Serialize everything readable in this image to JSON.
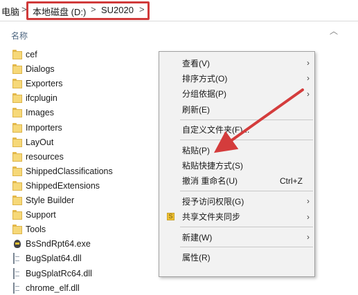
{
  "address_bar": {
    "crumbs": [
      "电脑",
      "本地磁盘 (D:)",
      "SU2020"
    ],
    "separator": ">"
  },
  "file_list": {
    "column_header": "名称",
    "items": [
      {
        "name": "cef",
        "type": "folder"
      },
      {
        "name": "Dialogs",
        "type": "folder"
      },
      {
        "name": "Exporters",
        "type": "folder"
      },
      {
        "name": "ifcplugin",
        "type": "folder"
      },
      {
        "name": "Images",
        "type": "folder"
      },
      {
        "name": "Importers",
        "type": "folder"
      },
      {
        "name": "LayOut",
        "type": "folder"
      },
      {
        "name": "resources",
        "type": "folder"
      },
      {
        "name": "ShippedClassifications",
        "type": "folder"
      },
      {
        "name": "ShippedExtensions",
        "type": "folder"
      },
      {
        "name": "Style Builder",
        "type": "folder"
      },
      {
        "name": "Support",
        "type": "folder"
      },
      {
        "name": "Tools",
        "type": "folder"
      },
      {
        "name": "BsSndRpt64.exe",
        "type": "exe"
      },
      {
        "name": "BugSplat64.dll",
        "type": "dll"
      },
      {
        "name": "BugSplatRc64.dll",
        "type": "dll"
      },
      {
        "name": "chrome_elf.dll",
        "type": "dll"
      }
    ]
  },
  "context_menu": {
    "items": [
      {
        "label": "查看(V)",
        "submenu": true
      },
      {
        "label": "排序方式(O)",
        "submenu": true
      },
      {
        "label": "分组依据(P)",
        "submenu": true
      },
      {
        "label": "刷新(E)"
      },
      {
        "separator": true
      },
      {
        "label": "自定义文件夹(F)..."
      },
      {
        "separator": true
      },
      {
        "label": "粘贴(P)"
      },
      {
        "label": "粘贴快捷方式(S)"
      },
      {
        "label": "撤消 重命名(U)",
        "shortcut": "Ctrl+Z"
      },
      {
        "separator": true
      },
      {
        "label": "授予访问权限(G)",
        "submenu": true
      },
      {
        "label": "共享文件夹同步",
        "submenu": true,
        "icon": "sync-folder-icon"
      },
      {
        "separator": true
      },
      {
        "label": "新建(W)",
        "submenu": true
      },
      {
        "separator": true
      },
      {
        "label": "属性(R)"
      }
    ],
    "arrow_glyph": "›"
  },
  "colors": {
    "highlight_box": "#d03a3a",
    "annotation_arrow": "#d43c3c",
    "folder_fill": "#f6d878"
  }
}
